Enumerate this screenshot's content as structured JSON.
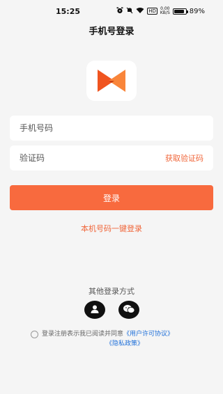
{
  "status_bar": {
    "time": "15:25",
    "network_speed": "0.00",
    "network_unit": "KB/S",
    "battery": "89%",
    "battery_level": 0.89
  },
  "page": {
    "title": "手机号登录"
  },
  "form": {
    "phone_placeholder": "手机号码",
    "code_placeholder": "验证码",
    "get_code_label": "获取验证码",
    "login_label": "登录",
    "one_key_login_label": "本机号码一键登录"
  },
  "other_login": {
    "label": "其他登录方式",
    "icons": [
      "user-icon",
      "wechat-icon"
    ]
  },
  "agreement": {
    "prefix": "登录注册表示我已阅读并同意",
    "user_agreement": "《用户许可协议》",
    "privacy_policy": "《隐私政策》"
  },
  "colors": {
    "accent": "#f86a3e",
    "link": "#1e6fd9",
    "background": "#f5f5f5"
  }
}
